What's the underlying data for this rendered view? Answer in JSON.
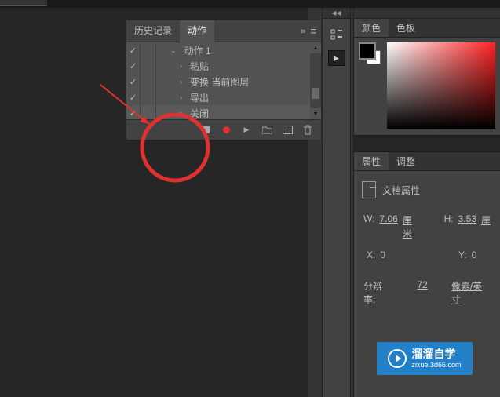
{
  "panels": {
    "actions": {
      "tabs": {
        "history": "历史记录",
        "actions": "动作"
      },
      "rows": [
        {
          "label": "动作 1",
          "indent": "less"
        },
        {
          "label": "粘贴"
        },
        {
          "label": "变换 当前图层"
        },
        {
          "label": "导出"
        },
        {
          "label": "关闭"
        }
      ]
    }
  },
  "color_panel": {
    "tabs": {
      "color": "颜色",
      "swatches": "色板"
    }
  },
  "attrs_panel": {
    "tabs": {
      "attrs": "属性",
      "adjust": "调整"
    },
    "title": "文档属性",
    "W_label": "W:",
    "W_value": "7.06",
    "W_unit": "厘米",
    "H_label": "H:",
    "H_value": "3.53",
    "H_unit": "厘",
    "X_label": "X:",
    "X_value": "0",
    "Y_label": "Y:",
    "Y_value": "0",
    "resolution_label": "分辨率:",
    "resolution_value": "72",
    "resolution_unit": "像素/英寸"
  },
  "watermark": {
    "line1": "溜溜自学",
    "line2": "zixue.3d66.com"
  },
  "icons": {
    "menu_more": "»",
    "menu_list": "☰",
    "check": "✓",
    "arrow_right": "›",
    "arrow_down": "⌄",
    "arrow_up_small": "▲",
    "arrow_down_small": "▼",
    "play": "▶",
    "collapse": "◀◀"
  }
}
